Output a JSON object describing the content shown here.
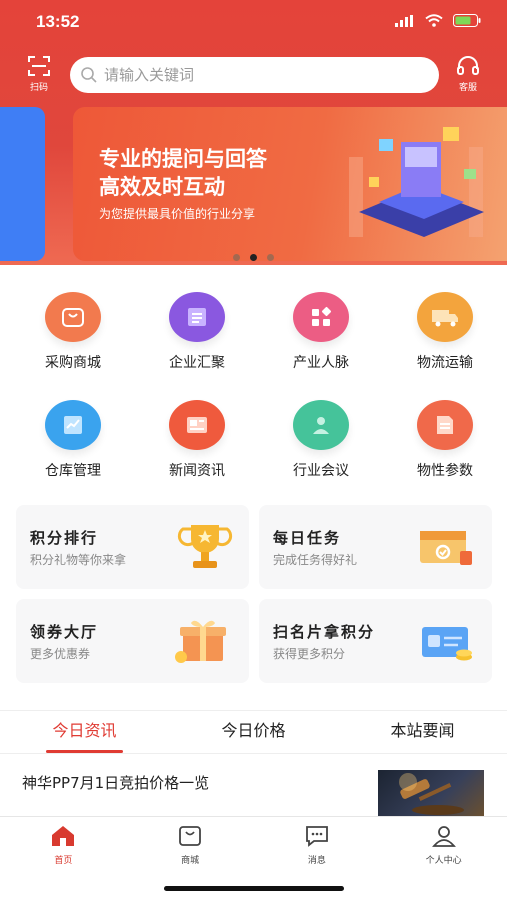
{
  "status": {
    "time": "13:52"
  },
  "header": {
    "scan_label": "扫码",
    "service_label": "客服",
    "search": {
      "placeholder": "请输入关键词",
      "value": ""
    }
  },
  "banner": {
    "title": "专业的提问与回答\n高效及时互动",
    "title_line1": "专业的提问与回答",
    "title_line2": "高效及时互动",
    "subtitle": "为您提供最具价值的行业分享",
    "page_count": 3,
    "active_index": 1
  },
  "grid": [
    {
      "label": "采购商城",
      "icon": "shopping-bag-icon",
      "color": "#f27a4e"
    },
    {
      "label": "企业汇聚",
      "icon": "building-doc-icon",
      "color": "#8a58e0"
    },
    {
      "label": "产业人脉",
      "icon": "blocks-icon",
      "color": "#ec5d84"
    },
    {
      "label": "物流运输",
      "icon": "truck-icon",
      "color": "#f3a43d"
    },
    {
      "label": "仓库管理",
      "icon": "chart-doc-icon",
      "color": "#3aa3ee"
    },
    {
      "label": "新闻资讯",
      "icon": "newspaper-icon",
      "color": "#ef5a3d"
    },
    {
      "label": "行业会议",
      "icon": "people-icon",
      "color": "#45c39a"
    },
    {
      "label": "物性参数",
      "icon": "document-icon",
      "color": "#f0694a"
    }
  ],
  "cards": [
    {
      "title": "积分排行",
      "subtitle": "积分礼物等你来拿",
      "icon": "trophy-icon"
    },
    {
      "title": "每日任务",
      "subtitle": "完成任务得好礼",
      "icon": "task-box-icon"
    },
    {
      "title": "领券大厅",
      "subtitle": "更多优惠券",
      "icon": "gift-coupon-icon"
    },
    {
      "title": "扫名片拿积分",
      "subtitle": "获得更多积分",
      "icon": "business-card-icon"
    }
  ],
  "tabs": [
    {
      "label": "今日资讯",
      "active": true
    },
    {
      "label": "今日价格",
      "active": false
    },
    {
      "label": "本站要闻",
      "active": false
    }
  ],
  "news": [
    {
      "title": "神华PP7月1日竞拍价格一览",
      "thumbnail": "auction-gavel-image"
    }
  ],
  "tabbar": [
    {
      "label": "首页",
      "icon": "home-icon",
      "active": true
    },
    {
      "label": "商城",
      "icon": "shopping-bag-icon",
      "active": false
    },
    {
      "label": "消息",
      "icon": "message-icon",
      "active": false
    },
    {
      "label": "个人中心",
      "icon": "user-icon",
      "active": false
    }
  ],
  "colors": {
    "brand": "#e3443a",
    "active_tab": "#e03b33"
  }
}
